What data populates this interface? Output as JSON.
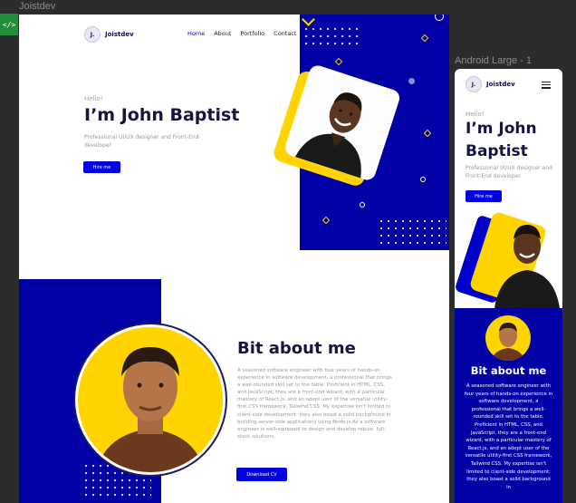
{
  "canvas": {
    "desktop_frame_label": "Joistdev",
    "mobile_frame_label": "Android Large - 1",
    "code_icon": "code-icon"
  },
  "brand": {
    "initial": "J.",
    "name": "Joistdev"
  },
  "nav": {
    "items": [
      "Home",
      "About",
      "Portfolio",
      "Contact"
    ],
    "active": "Home"
  },
  "hero": {
    "greeting": "Hello!",
    "name": "I’m John Baptist",
    "name_line1": "I’m John",
    "name_line2": "Baptist",
    "subtitle": "Professional UI/UX designer and  Front-End developer",
    "cta": "Hire me"
  },
  "about": {
    "title": "Bit about me",
    "body": "A seasoned software engineer with four years of hands-on experience in software development, a professional that brings a well-rounded skill set to the table. Proficient in HTML, CSS, and JavaScript, they are a front-end wizard, with a particular mastery of React.js, and an adept user of the versatile utility-first CSS framework, Tailwind CSS. My expertise isn't limited to client-side development; they also boast a solid background in building server-side applications using Node.js.As a software engineer is well-equipped to design and develop robust, full-stack solutions.",
    "mobile_body": "A seasoned software engineer with four years of hands-on experience in software development, a professional that brings a well-rounded skill set to the table. Proficient in HTML, CSS, and JavaScript, they are a front-end wizard, with a particular mastery of React.js, and an adept user of the versatile utility-first CSS framework, Tailwind CSS. My expertise isn't limited to client-side development; they also boast a solid background in",
    "cta": "Download CV"
  },
  "colors": {
    "primary_blue": "#0000a5",
    "button_blue": "#0000e0",
    "accent_yellow": "#ffd400",
    "heading": "#151540"
  }
}
